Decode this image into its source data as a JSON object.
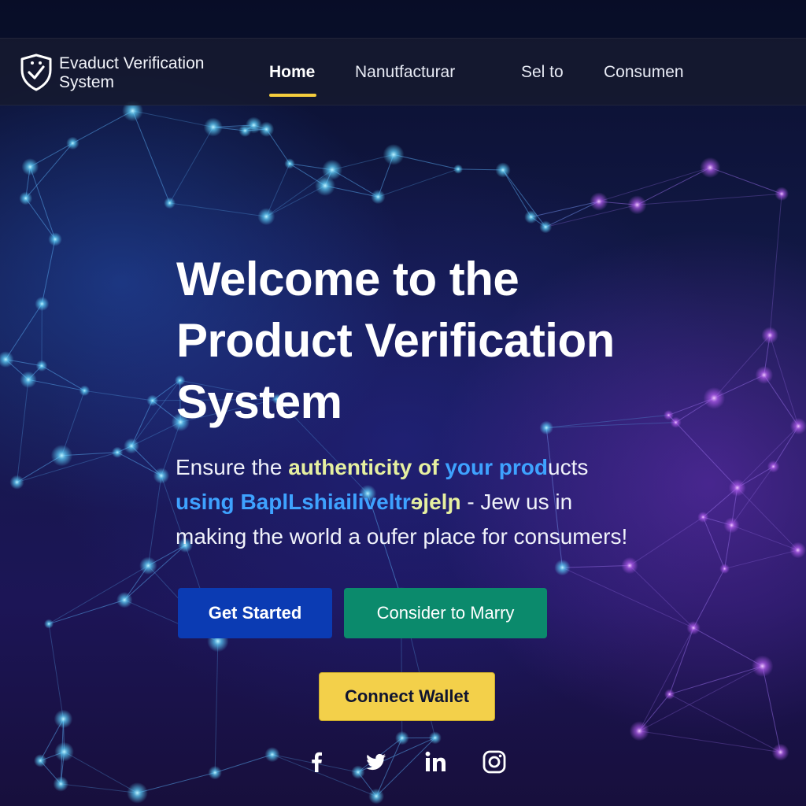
{
  "brand": {
    "name_line1": "Evaduct Verification",
    "name_line2": "System",
    "logo_icon": "shield-check-icon"
  },
  "nav": {
    "items": [
      {
        "label": "Home",
        "active": true
      },
      {
        "label": "Nanutfacturar",
        "active": false
      },
      {
        "label": "Sel to",
        "active": false
      },
      {
        "label": "Consumen",
        "active": false
      }
    ]
  },
  "hero": {
    "title_line1": "Welcome to the",
    "title_line2": "Product Verification",
    "title_line3": "System",
    "subtitle": {
      "part1": "Ensure the ",
      "part2": "authenticity of",
      "part3": " your prod",
      "part4": "ucts",
      "part5": "using BaplLshiailiveltr",
      "part6": "ɘjelɲ",
      "part7": " - Jew us in",
      "part8": "making the world a oufer place for consumers!"
    }
  },
  "buttons": {
    "get_started": "Get Started",
    "consider": "Consider to Marry",
    "connect_wallet": "Connect Wallet"
  },
  "social": [
    "facebook-icon",
    "twitter-icon",
    "linkedin-icon",
    "instagram-icon"
  ],
  "colors": {
    "accent_yellow": "#f3d04a",
    "primary_blue": "#0b3bb3",
    "green": "#0b8a6c",
    "highlight_blue": "#3ea2ff"
  }
}
